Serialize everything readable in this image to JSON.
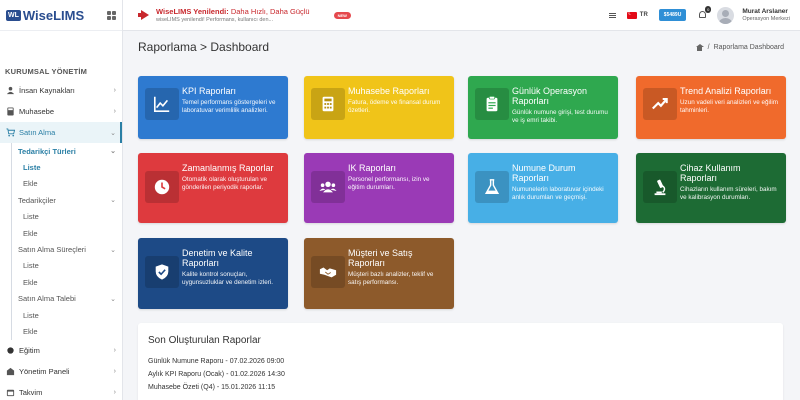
{
  "brand": {
    "badge": "WL",
    "name": "WiseLIMS"
  },
  "topbar": {
    "announcement_title_bold": "WiseLIMS Yenilendi:",
    "announcement_title_rest": " Daha Hızlı, Daha Güçlü",
    "announcement_desc": "wiseLIMS yenilendi! Performans, kullanıcı den...",
    "new_badge": "NEW",
    "lang": "TR",
    "balance": "$5489U",
    "notif_count": "0",
    "user_name": "Murat Arslaner",
    "user_org": "Operasyon Merkezi"
  },
  "sidebar": {
    "section": "KURUMSAL YÖNETİM",
    "items": [
      {
        "label": "İnsan Kaynakları",
        "icon": "users-icon"
      },
      {
        "label": "Muhasebe",
        "icon": "calculator-icon"
      },
      {
        "label": "Satın Alma",
        "icon": "cart-icon"
      },
      {
        "label": "Eğitim",
        "icon": "education-icon"
      },
      {
        "label": "Yönetim Paneli",
        "icon": "dashboard-icon"
      },
      {
        "label": "Takvim",
        "icon": "calendar-icon"
      }
    ],
    "satin_alma_sub": [
      {
        "label": "Tedarikçi Türleri",
        "children": [
          "Liste",
          "Ekle"
        ]
      },
      {
        "label": "Tedarikçiler",
        "children": [
          "Liste",
          "Ekle"
        ]
      },
      {
        "label": "Satın Alma Süreçleri",
        "children": [
          "Liste",
          "Ekle"
        ]
      },
      {
        "label": "Satın Alma Talebi",
        "children": [
          "Liste",
          "Ekle"
        ]
      }
    ]
  },
  "page": {
    "title": "Raporlama > Dashboard",
    "breadcrumb": "Raporlama Dashboard",
    "breadcrumb_sep": "/"
  },
  "cards": [
    {
      "title": "KPI Raporları",
      "desc": "Temel performans göstergeleri ve laboratuvar verimlilik analizleri.",
      "color": "#2e7ad0",
      "icon": "chart-line-icon"
    },
    {
      "title": "Muhasebe Raporları",
      "desc": "Fatura, ödeme ve finansal durum özetleri.",
      "color": "#f0c419",
      "icon": "calculator-icon"
    },
    {
      "title": "Günlük Operasyon Raporları",
      "desc": "Günlük numune girişi, test durumu ve iş emri takibi.",
      "color": "#2fa84f",
      "icon": "clipboard-icon"
    },
    {
      "title": "Trend Analizi Raporları",
      "desc": "Uzun vadeli veri analizleri ve eğilim tahminleri.",
      "color": "#f06a2c",
      "icon": "trend-up-icon"
    },
    {
      "title": "Zamanlanmış Raporlar",
      "desc": "Otomatik olarak oluşturulan ve gönderilen periyodik raporlar.",
      "color": "#de3a3e",
      "icon": "clock-icon"
    },
    {
      "title": "IK Raporları",
      "desc": "Personel performansı, izin ve eğitim durumları.",
      "color": "#9a3ab6",
      "icon": "team-icon"
    },
    {
      "title": "Numune Durum Raporları",
      "desc": "Numunelerin laboratuvar içindeki anlık durumları ve geçmişi.",
      "color": "#47afe6",
      "icon": "flask-icon"
    },
    {
      "title": "Cihaz Kullanım Raporları",
      "desc": "Cihazların kullanım süreleri, bakım ve kalibrasyon durumları.",
      "color": "#1d6b34",
      "icon": "microscope-icon"
    },
    {
      "title": "Denetim ve Kalite Raporları",
      "desc": "Kalite kontrol sonuçları, uygunsuzluklar ve denetim izleri.",
      "color": "#1d4a86",
      "icon": "shield-check-icon"
    },
    {
      "title": "Müşteri ve Satış Raporları",
      "desc": "Müşteri bazlı analizler, teklif ve satış performansı.",
      "color": "#8d5a2b",
      "icon": "handshake-icon"
    }
  ],
  "recent": {
    "title": "Son Oluşturulan Raporlar",
    "items": [
      "Günlük Numune Raporu - 07.02.2026 09:00",
      "Aylık KPI Raporu (Ocak) - 01.02.2026 14:30",
      "Muhasebe Özeti (Q4) - 15.01.2026 11:15"
    ]
  }
}
